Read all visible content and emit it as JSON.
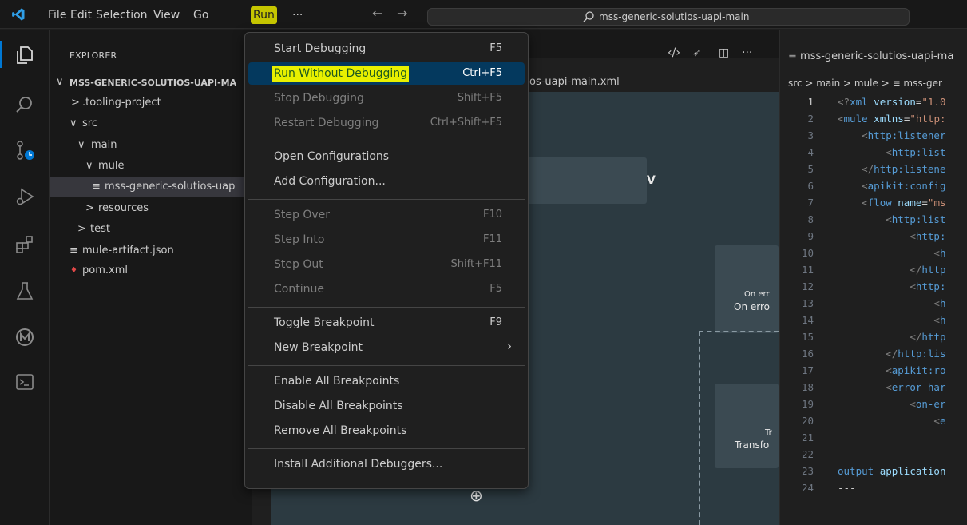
{
  "titlebar": {
    "menus": [
      "File",
      "Edit",
      "Selection",
      "View",
      "Go",
      "Run",
      "···"
    ],
    "active_menu": "Run",
    "command_center": "mss-generic-solutios-uapi-main"
  },
  "activity_icons": [
    "explorer-icon",
    "search-icon",
    "source-control-icon",
    "run-debug-icon",
    "extensions-icon",
    "testing-icon",
    "mulesoft-icon",
    "terminal-icon"
  ],
  "sidebar": {
    "header": "EXPLORER",
    "root": "MSS-GENERIC-SOLUTIOS-UAPI-MA",
    "tree": [
      {
        "label": ".tooling-project",
        "chevron": ">"
      },
      {
        "label": "src",
        "chevron": "∨"
      },
      {
        "label": "main",
        "chevron": "∨"
      },
      {
        "label": "mule",
        "chevron": "∨"
      },
      {
        "label": "mss-generic-solutios-uap",
        "icon": "≡"
      },
      {
        "label": "resources",
        "chevron": ">"
      },
      {
        "label": "test",
        "chevron": ">"
      },
      {
        "label": "mule-artifact.json",
        "icon": "≡"
      },
      {
        "label": "pom.xml",
        "icon": "♦"
      }
    ]
  },
  "editor": {
    "breadcrumb_fragment": "os-uapi-main.xml",
    "toolbar_icons": [
      "‹/›",
      "➶",
      "◫",
      "···"
    ],
    "chevron": "V",
    "labels": {
      "on_error_small": "On err",
      "on_error": "On erro",
      "transform_small": "Tr",
      "transform": "Transfo"
    },
    "add_icon": "⊕"
  },
  "codepanel": {
    "title": "mss-generic-solutios-uapi-ma",
    "breadcrumb": "src > main > mule > ≡ mss-ger",
    "lines": [
      {
        "n": "1",
        "segs": [
          [
            "ptag",
            "<?"
          ],
          [
            "tag",
            "xml "
          ],
          [
            "attr",
            "version"
          ],
          [
            "plain",
            "="
          ],
          [
            "str",
            "\"1.0"
          ]
        ]
      },
      {
        "n": "2",
        "segs": [
          [
            "ptag",
            "<"
          ],
          [
            "tag",
            "mule "
          ],
          [
            "attr",
            "xmlns"
          ],
          [
            "plain",
            "="
          ],
          [
            "str",
            "\"http:"
          ]
        ]
      },
      {
        "n": "3",
        "segs": [
          [
            "plain",
            "    "
          ],
          [
            "ptag",
            "<"
          ],
          [
            "tag",
            "http:listener"
          ]
        ]
      },
      {
        "n": "4",
        "segs": [
          [
            "plain",
            "        "
          ],
          [
            "ptag",
            "<"
          ],
          [
            "tag",
            "http:list"
          ]
        ]
      },
      {
        "n": "5",
        "segs": [
          [
            "plain",
            "    "
          ],
          [
            "ptag",
            "</"
          ],
          [
            "tag",
            "http:listene"
          ]
        ]
      },
      {
        "n": "6",
        "segs": [
          [
            "plain",
            "    "
          ],
          [
            "ptag",
            "<"
          ],
          [
            "tag",
            "apikit:config"
          ]
        ]
      },
      {
        "n": "7",
        "segs": [
          [
            "plain",
            "    "
          ],
          [
            "ptag",
            "<"
          ],
          [
            "tag",
            "flow "
          ],
          [
            "attr",
            "name"
          ],
          [
            "plain",
            "="
          ],
          [
            "str",
            "\"ms"
          ]
        ]
      },
      {
        "n": "8",
        "segs": [
          [
            "plain",
            "        "
          ],
          [
            "ptag",
            "<"
          ],
          [
            "tag",
            "http:list"
          ]
        ]
      },
      {
        "n": "9",
        "segs": [
          [
            "plain",
            "            "
          ],
          [
            "ptag",
            "<"
          ],
          [
            "tag",
            "http:"
          ]
        ]
      },
      {
        "n": "10",
        "segs": [
          [
            "plain",
            "                "
          ],
          [
            "ptag",
            "<"
          ],
          [
            "tag",
            "h"
          ]
        ]
      },
      {
        "n": "11",
        "segs": [
          [
            "plain",
            "            "
          ],
          [
            "ptag",
            "</"
          ],
          [
            "tag",
            "http"
          ]
        ]
      },
      {
        "n": "12",
        "segs": [
          [
            "plain",
            "            "
          ],
          [
            "ptag",
            "<"
          ],
          [
            "tag",
            "http:"
          ]
        ]
      },
      {
        "n": "13",
        "segs": [
          [
            "plain",
            "                "
          ],
          [
            "ptag",
            "<"
          ],
          [
            "tag",
            "h"
          ]
        ]
      },
      {
        "n": "14",
        "segs": [
          [
            "plain",
            "                "
          ],
          [
            "ptag",
            "<"
          ],
          [
            "tag",
            "h"
          ]
        ]
      },
      {
        "n": "15",
        "segs": [
          [
            "plain",
            "            "
          ],
          [
            "ptag",
            "</"
          ],
          [
            "tag",
            "http"
          ]
        ]
      },
      {
        "n": "16",
        "segs": [
          [
            "plain",
            "        "
          ],
          [
            "ptag",
            "</"
          ],
          [
            "tag",
            "http:lis"
          ]
        ]
      },
      {
        "n": "17",
        "segs": [
          [
            "plain",
            "        "
          ],
          [
            "ptag",
            "<"
          ],
          [
            "tag",
            "apikit:ro"
          ]
        ]
      },
      {
        "n": "18",
        "segs": [
          [
            "plain",
            "        "
          ],
          [
            "ptag",
            "<"
          ],
          [
            "tag",
            "error-har"
          ]
        ]
      },
      {
        "n": "19",
        "segs": [
          [
            "plain",
            "            "
          ],
          [
            "ptag",
            "<"
          ],
          [
            "tag",
            "on-er"
          ]
        ]
      },
      {
        "n": "20",
        "segs": [
          [
            "plain",
            "                "
          ],
          [
            "ptag",
            "<"
          ],
          [
            "tag",
            "e"
          ]
        ]
      },
      {
        "n": "21",
        "segs": []
      },
      {
        "n": "22",
        "segs": []
      },
      {
        "n": "23",
        "segs": [
          [
            "tag",
            "output "
          ],
          [
            "attr",
            "application"
          ]
        ]
      },
      {
        "n": "24",
        "segs": [
          [
            "plain",
            "---"
          ]
        ]
      }
    ]
  },
  "run_menu": {
    "items": [
      {
        "label": "Start Debugging",
        "shortcut": "F5",
        "enabled": true
      },
      {
        "label": "Run Without Debugging",
        "shortcut": "Ctrl+F5",
        "enabled": true,
        "highlighted": true
      },
      {
        "label": "Stop Debugging",
        "shortcut": "Shift+F5",
        "enabled": false
      },
      {
        "label": "Restart Debugging",
        "shortcut": "Ctrl+Shift+F5",
        "enabled": false
      },
      {
        "sep": true
      },
      {
        "label": "Open Configurations",
        "shortcut": "",
        "enabled": true
      },
      {
        "label": "Add Configuration...",
        "shortcut": "",
        "enabled": true
      },
      {
        "sep": true
      },
      {
        "label": "Step Over",
        "shortcut": "F10",
        "enabled": false
      },
      {
        "label": "Step Into",
        "shortcut": "F11",
        "enabled": false
      },
      {
        "label": "Step Out",
        "shortcut": "Shift+F11",
        "enabled": false
      },
      {
        "label": "Continue",
        "shortcut": "F5",
        "enabled": false
      },
      {
        "sep": true
      },
      {
        "label": "Toggle Breakpoint",
        "shortcut": "F9",
        "enabled": true
      },
      {
        "label": "New Breakpoint",
        "shortcut": "",
        "enabled": true,
        "submenu": true
      },
      {
        "sep": true
      },
      {
        "label": "Enable All Breakpoints",
        "shortcut": "",
        "enabled": true
      },
      {
        "label": "Disable All Breakpoints",
        "shortcut": "",
        "enabled": true
      },
      {
        "label": "Remove All Breakpoints",
        "shortcut": "",
        "enabled": true
      },
      {
        "sep": true
      },
      {
        "label": "Install Additional Debuggers...",
        "shortcut": "",
        "enabled": true
      }
    ]
  },
  "colors": {
    "accent": "#0078d4",
    "menu_highlight": "#04395e",
    "run_menu_active": "#c5c500"
  }
}
